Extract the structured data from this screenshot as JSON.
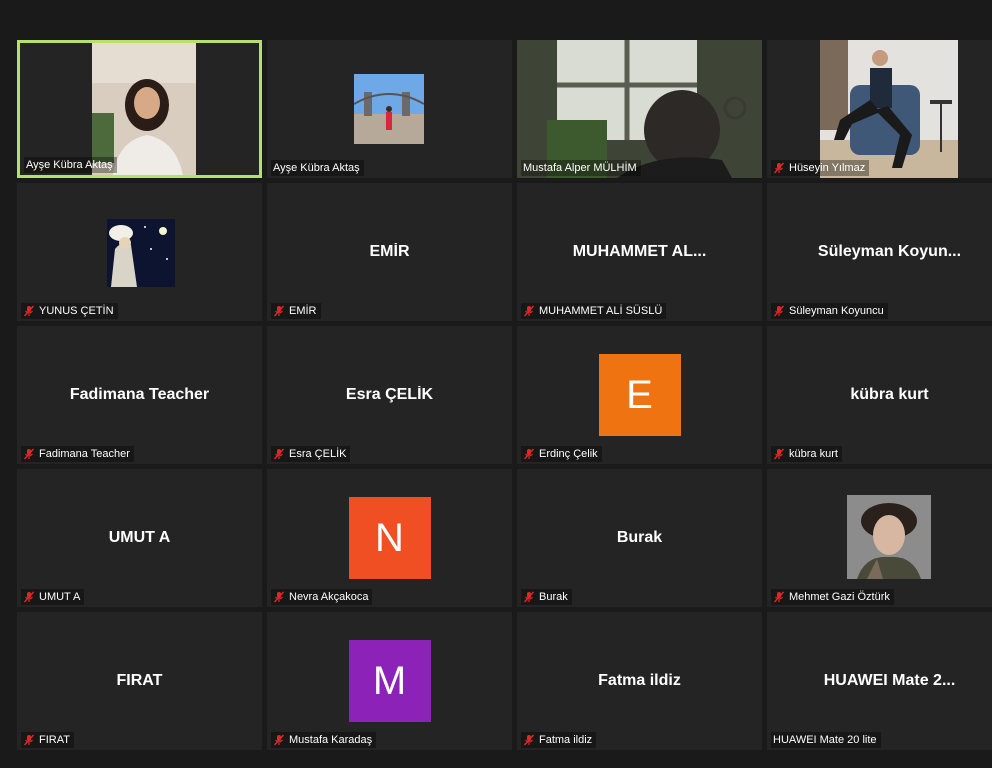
{
  "participants": [
    {
      "name": "Ayşe Kübra Aktaş",
      "type": "video-self",
      "muted": false
    },
    {
      "name": "Ayşe Kübra Aktaş",
      "type": "picture",
      "muted": false
    },
    {
      "name": "Mustafa Alper MÜLHİM",
      "type": "video-room",
      "muted": false
    },
    {
      "name": "Hüseyin Yılmaz",
      "type": "video-chair",
      "muted": true
    },
    {
      "name": "YUNUS ÇETİN",
      "type": "picture-moon",
      "muted": true
    },
    {
      "name": "EMİR",
      "display": "EMİR",
      "type": "text",
      "muted": true
    },
    {
      "name": "MUHAMMET ALİ SÜSLÜ",
      "display": "MUHAMMET  AL...",
      "type": "text",
      "muted": true
    },
    {
      "name": "Süleyman Koyuncu",
      "display": "Süleyman  Koyun...",
      "type": "text",
      "muted": true
    },
    {
      "name": "Fadimana  Teacher",
      "display": "Fadimana  Teacher",
      "type": "text",
      "muted": true
    },
    {
      "name": "Esra ÇELİK",
      "display": "Esra ÇELİK",
      "type": "text",
      "muted": true
    },
    {
      "name": "Erdinç Çelik",
      "letter": "E",
      "avatar_color": "#f07311",
      "type": "letter",
      "muted": true
    },
    {
      "name": "kübra kurt",
      "display": "kübra kurt",
      "type": "text",
      "muted": true
    },
    {
      "name": "UMUT A",
      "display": "UMUT A",
      "type": "text",
      "muted": true
    },
    {
      "name": "Nevra Akçakoca",
      "letter": "N",
      "avatar_color": "#f04e23",
      "type": "letter",
      "muted": true
    },
    {
      "name": "Burak",
      "display": "Burak",
      "type": "text",
      "muted": true
    },
    {
      "name": "Mehmet Gazi Öztürk",
      "type": "picture-face",
      "muted": true
    },
    {
      "name": "FIRAT",
      "display": "FIRAT",
      "type": "text",
      "muted": true
    },
    {
      "name": "Mustafa Karadaş",
      "letter": "M",
      "avatar_color": "#8d22b8",
      "type": "letter",
      "muted": true
    },
    {
      "name": "Fatma ildiz",
      "display": "Fatma ildiz",
      "type": "text",
      "muted": true
    },
    {
      "name": "HUAWEI Mate 20 lite",
      "display": "HUAWEI  Mate  2...",
      "type": "text",
      "muted": false
    }
  ],
  "colors": {
    "active_border": "#b6e06a",
    "tile_bg": "#242424",
    "mute_red": "#e02828"
  }
}
